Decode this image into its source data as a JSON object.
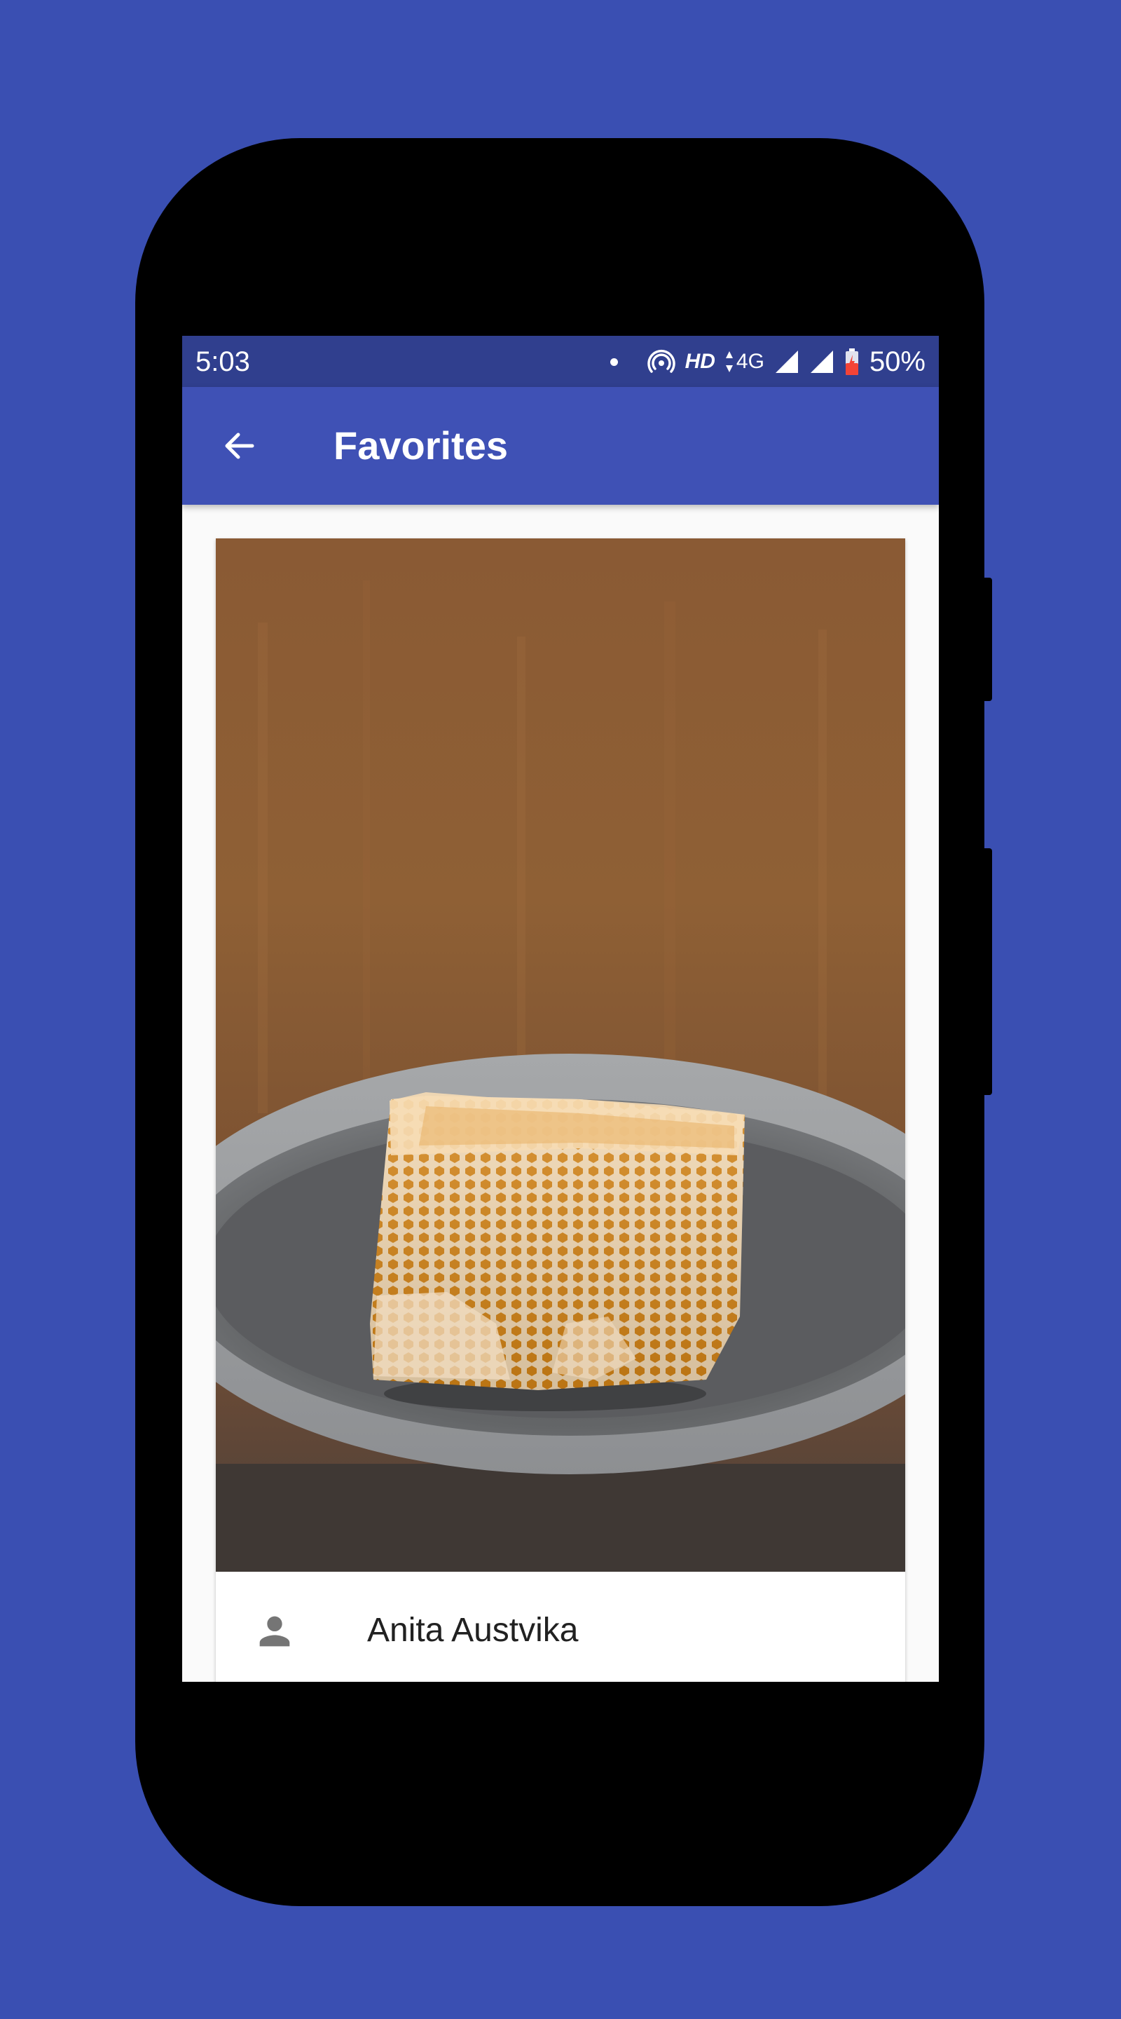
{
  "status_bar": {
    "time": "5:03",
    "hd": "HD",
    "network": "4G",
    "battery": "50%",
    "icons": [
      "notification-dot-icon",
      "hotspot-icon",
      "data-arrows-icon",
      "signal-icon",
      "signal-icon",
      "battery-charging-icon"
    ]
  },
  "app_bar": {
    "title": "Favorites",
    "back_icon": "arrow-back-icon",
    "background": "#3f51b5",
    "status_background": "#303f8e"
  },
  "card": {
    "image_subject": "honeycomb on a plate",
    "author": "Anita Austvika",
    "author_icon": "person-icon"
  },
  "colors": {
    "page_background": "#3a4fb2",
    "accent": "#3f51b5"
  }
}
